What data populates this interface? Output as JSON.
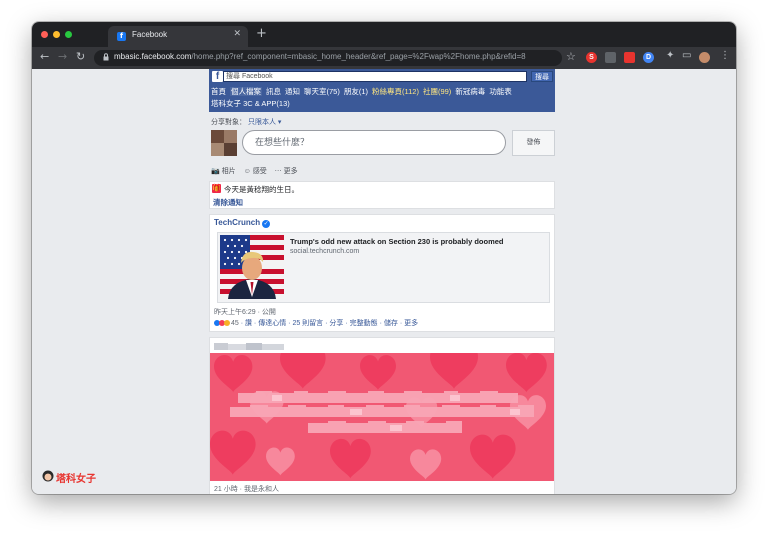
{
  "browser": {
    "tab_title": "Facebook",
    "url_host": "mbasic.facebook.com",
    "url_path": "/home.php?ref_component=mbasic_home_header&ref_page=%2Fwap%2Fhome.php&refid=8",
    "extensions": [
      {
        "label": "S",
        "color": "#e8342f"
      },
      {
        "label": "",
        "color": "#5f6368"
      },
      {
        "label": "",
        "color": "#e8342f"
      },
      {
        "label": "D",
        "color": "#4285f4"
      }
    ]
  },
  "fb": {
    "search_placeholder": "搜尋 Facebook",
    "search_button": "搜尋",
    "menu": [
      {
        "label": "首頁",
        "state": "normal"
      },
      {
        "label": "個人檔案",
        "state": "active"
      },
      {
        "label": "訊息",
        "state": "normal"
      },
      {
        "label": "通知",
        "state": "normal"
      },
      {
        "label": "聊天室(75)",
        "state": "normal"
      },
      {
        "label": "朋友(1)",
        "state": "normal"
      },
      {
        "label": "粉絲專頁(112)",
        "state": "highlight"
      },
      {
        "label": "社團(99)",
        "state": "highlight"
      },
      {
        "label": "新冠病毒",
        "state": "normal"
      },
      {
        "label": "功能表",
        "state": "normal"
      },
      {
        "label": "塔科女子 3C & APP(13)",
        "state": "normal"
      }
    ],
    "share_label": "分享對象：",
    "audience": "只限本人 ▾",
    "composer_placeholder": "在想些什麼？",
    "post_button": "發佈",
    "attach": [
      "📷 相片",
      "☺ 感受",
      "⋯ 更多"
    ],
    "birthday": {
      "text": "今天是黃稔翔的生日。",
      "clear": "清除通知"
    },
    "post": {
      "page": "TechCrunch",
      "link_title": "Trump's odd new attack on Section 230 is probably doomed",
      "link_domain": "social.techcrunch.com",
      "meta": "昨天上午6:29 · 公開",
      "reaction_count": "45",
      "actions": [
        "讚",
        "傳達心情",
        "25 則留言",
        "分享",
        "完整動態",
        "儲存",
        "更多"
      ]
    },
    "post2": {
      "meta": "21 小時 · 我是永和人"
    }
  },
  "watermark": "塔科女子"
}
